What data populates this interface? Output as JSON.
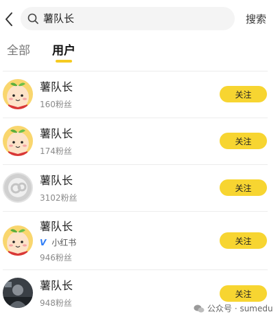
{
  "search": {
    "query": "薯队长",
    "action_label": "搜索"
  },
  "tabs": [
    {
      "label": "全部",
      "active": false
    },
    {
      "label": "用户",
      "active": true
    }
  ],
  "users": [
    {
      "name": "薯队长",
      "fans": "160粉丝",
      "follow_label": "关注",
      "avatar": "potato-avatar"
    },
    {
      "name": "薯队长",
      "fans": "174粉丝",
      "follow_label": "关注",
      "avatar": "potato-avatar"
    },
    {
      "name": "薯队长",
      "fans": "3102粉丝",
      "follow_label": "关注",
      "avatar": "gray-default-avatar"
    },
    {
      "name": "薯队长",
      "verified_mark": "V",
      "verified_text": "小红书",
      "fans": "946粉丝",
      "follow_label": "关注",
      "avatar": "potato-avatar"
    },
    {
      "name": "薯队长",
      "fans": "948粉丝",
      "follow_label": "关注",
      "avatar": "photo-avatar"
    }
  ],
  "watermark": {
    "text": "公众号 · sumedu"
  },
  "colors": {
    "accent": "#f7d531",
    "tab_indicator": "#f5cb22",
    "verified": "#2d7cf6"
  }
}
